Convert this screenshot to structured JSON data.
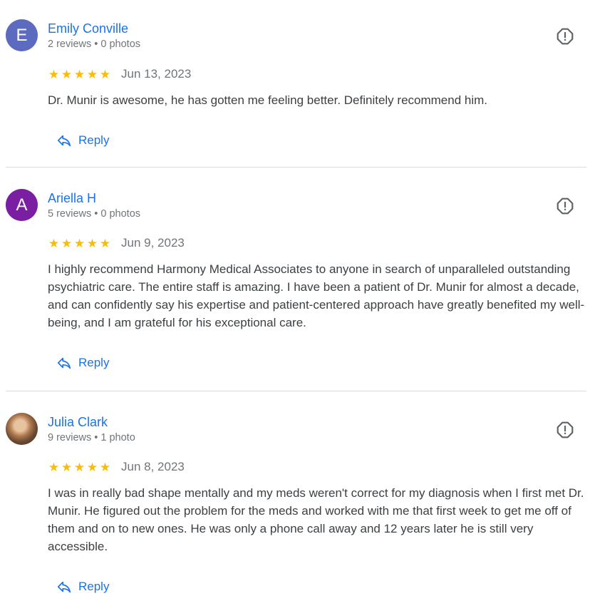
{
  "colors": {
    "link": "#1a73e8",
    "star": "#fbbc04",
    "meta": "#70757a"
  },
  "reviews": [
    {
      "avatar_letter": "E",
      "avatar_color": "#5c6bc0",
      "name": "Emily Conville",
      "meta": "2 reviews • 0 photos",
      "rating": 5,
      "date": "Jun 13, 2023",
      "text": "Dr. Munir is awesome, he has gotten me feeling better. Definitely recommend him.",
      "reply_label": "Reply"
    },
    {
      "avatar_letter": "A",
      "avatar_color": "#7b1fa2",
      "name": "Ariella H",
      "meta": "5 reviews • 0 photos",
      "rating": 5,
      "date": "Jun 9, 2023",
      "text": "I highly recommend Harmony Medical Associates to anyone in search of unparalleled outstanding psychiatric care. The entire staff is amazing. I have been a patient of Dr. Munir for almost a decade, and can confidently say his expertise and patient-centered approach have greatly benefited my well-being, and I am grateful for his exceptional care.",
      "reply_label": "Reply"
    },
    {
      "avatar_letter": "",
      "avatar_color": "",
      "name": "Julia Clark",
      "meta": "9 reviews • 1 photo",
      "rating": 5,
      "date": "Jun 8, 2023",
      "text": "I was in really bad shape mentally and my meds weren't correct for my diagnosis when I first met Dr. Munir. He figured out the problem for the meds and worked with me that first week to get me off of them and on to new ones. He was only a phone call away and 12 years later he is still very accessible.",
      "reply_label": "Reply"
    }
  ],
  "icons": {
    "report": "report-flag-icon",
    "reply": "reply-arrow-icon",
    "star": "star-icon"
  }
}
